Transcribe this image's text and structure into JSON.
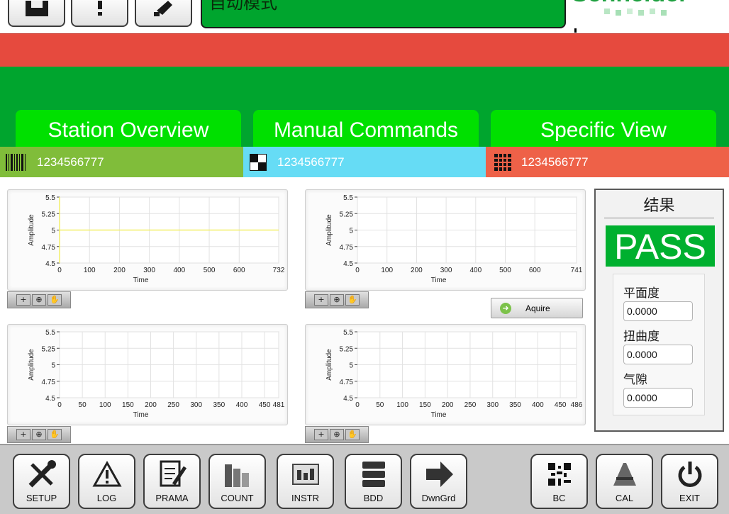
{
  "header": {
    "mode_label": "自动模式",
    "brand": "Schneider"
  },
  "tabs": [
    {
      "label": "Station Overview"
    },
    {
      "label": "Manual Commands"
    },
    {
      "label": "Specific View"
    }
  ],
  "info_bar": [
    {
      "icon": "barcode-icon",
      "value": "1234566777",
      "color": "#80bd3a"
    },
    {
      "icon": "qr-square-icon",
      "value": "1234566777",
      "color": "#66dcf5"
    },
    {
      "icon": "datamatrix-icon",
      "value": "1234566777",
      "color": "#ee6148"
    }
  ],
  "charts": [
    {
      "ylabel": "Amplitude",
      "xlabel": "Time",
      "y_ticks": [
        "5.5",
        "5.25",
        "5",
        "4.75",
        "4.5"
      ],
      "x_ticks": [
        "0",
        "100",
        "200",
        "300",
        "400",
        "500",
        "600",
        "732"
      ]
    },
    {
      "ylabel": "Amplitude",
      "xlabel": "Time",
      "y_ticks": [
        "5.5",
        "5.25",
        "5",
        "4.75",
        "4.5"
      ],
      "x_ticks": [
        "0",
        "100",
        "200",
        "300",
        "400",
        "500",
        "600",
        "741"
      ]
    },
    {
      "ylabel": "Amplitude",
      "xlabel": "Time",
      "y_ticks": [
        "5.5",
        "5.25",
        "5",
        "4.75",
        "4.5"
      ],
      "x_ticks": [
        "0",
        "50",
        "100",
        "150",
        "200",
        "250",
        "300",
        "350",
        "400",
        "450",
        "481"
      ]
    },
    {
      "ylabel": "Amplitude",
      "xlabel": "Time",
      "y_ticks": [
        "5.5",
        "5.25",
        "5",
        "4.75",
        "4.5"
      ],
      "x_ticks": [
        "0",
        "50",
        "100",
        "150",
        "200",
        "250",
        "300",
        "350",
        "400",
        "450",
        "486"
      ]
    }
  ],
  "chart_data": [
    {
      "type": "line",
      "xlabel": "Time",
      "ylabel": "Amplitude",
      "xlim": [
        0,
        732
      ],
      "ylim": [
        4.5,
        5.5
      ],
      "series": [
        {
          "x": [
            0,
            732
          ],
          "y": [
            5,
            5
          ],
          "color": "#f2ef6a"
        }
      ]
    },
    {
      "type": "line",
      "xlabel": "Time",
      "ylabel": "Amplitude",
      "xlim": [
        0,
        741
      ],
      "ylim": [
        4.5,
        5.5
      ],
      "series": []
    },
    {
      "type": "line",
      "xlabel": "Time",
      "ylabel": "Amplitude",
      "xlim": [
        0,
        481
      ],
      "ylim": [
        4.5,
        5.5
      ],
      "series": []
    },
    {
      "type": "line",
      "xlabel": "Time",
      "ylabel": "Amplitude",
      "xlim": [
        0,
        486
      ],
      "ylim": [
        4.5,
        5.5
      ],
      "series": []
    }
  ],
  "acquire_button": {
    "label": "Aquire"
  },
  "result": {
    "title": "结果",
    "status": "PASS",
    "fields": [
      {
        "label": "平面度",
        "value": "0.0000"
      },
      {
        "label": "扭曲度",
        "value": "0.0000"
      },
      {
        "label": "气隙",
        "value": "0.0000"
      }
    ]
  },
  "toolbar": [
    {
      "label": "SETUP",
      "icon": "tools-icon"
    },
    {
      "label": "LOG",
      "icon": "warning-icon"
    },
    {
      "label": "PRAMA",
      "icon": "edit-document-icon"
    },
    {
      "label": "COUNT",
      "icon": "bar-stack-icon"
    },
    {
      "label": "INSTR",
      "icon": "sliders-icon"
    },
    {
      "label": "BDD",
      "icon": "database-icon"
    },
    {
      "label": "DwnGrd",
      "icon": "arrow-right-icon"
    },
    {
      "label": "BC",
      "icon": "qr-code-icon"
    },
    {
      "label": "CAL",
      "icon": "calibration-icon"
    },
    {
      "label": "EXIT",
      "icon": "power-icon"
    }
  ]
}
